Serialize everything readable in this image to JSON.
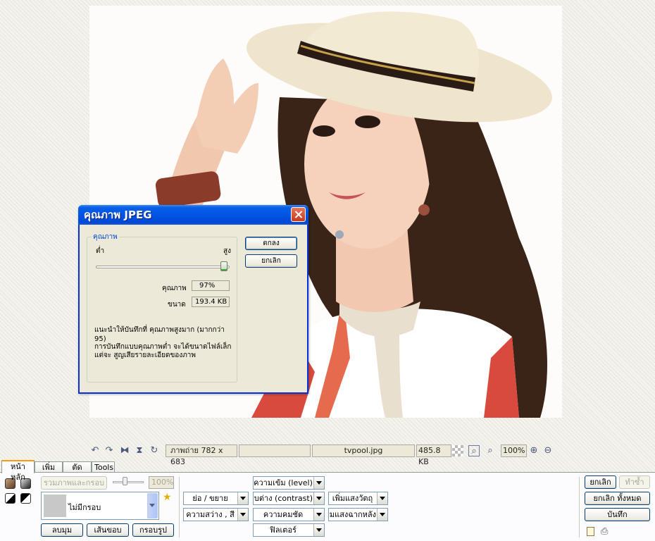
{
  "dialog": {
    "title": "คุณภาพ JPEG",
    "group_label": "คุณภาพ",
    "low_label": "ต่ำ",
    "high_label": "สูง",
    "quality_label": "คุณภาพ",
    "quality_value": "97%",
    "quality_slider_percent": 97,
    "size_label": "ขนาด",
    "size_value": "193.4 KB",
    "tip_line1": "แนะนำให้บันทึกที่ คุณภาพสูงมาก (มากกว่า 95)",
    "tip_line2": "การบันทึกแบบคุณภาพต่ำ จะได้ขนาดไฟล์เล็ก",
    "tip_line3": "แต่จะ สูญเสียรายละเอียดของภาพ",
    "ok_label": "ตกลง",
    "cancel_label": "ยกเลิก"
  },
  "status": {
    "dimensions": "ภาพถ่าย 782 x 683",
    "extra": "",
    "filename": "tvpool.jpg",
    "filesize": "485.8 KB",
    "zoom": "100%"
  },
  "tabs": [
    "หน้าหลัก",
    "เพิ่มวัตถุ",
    "ตัดภาพ",
    "Tools"
  ],
  "frame": {
    "merge_label": "รวมภาพและกรอบ",
    "opacity": "100%",
    "frame_selected": "ไม่มีกรอบ",
    "corner_label": "ลบมุม",
    "border_label": "เส้นขอบ",
    "shape_label": "กรอบรูป"
  },
  "adjust": {
    "resize": "ย่อ / ขยาย",
    "brightness": "ความสว่าง , สี",
    "level": "ความเข้ม (level)",
    "contrast": "เปรียบต่าง (contrast)",
    "sharpen": "ความคมชัด",
    "filter": "ฟิลเตอร์",
    "light_object": "เพิ่มแสงวัตถุ",
    "light_bg": "เพิ่มแสงฉากหลัง"
  },
  "actions": {
    "undo": "ยกเลิก",
    "redo": "ทำซ้ำ",
    "undo_all": "ยกเลิก ทั้งหมด",
    "save": "บันทึก"
  },
  "icons": {
    "rotate_left": "rotate-left-icon",
    "rotate_right": "rotate-right-icon",
    "flip_h": "flip-horizontal-icon",
    "flip_v": "flip-vertical-icon",
    "zoom_fit": "zoom-fit-icon",
    "zoom_actual": "zoom-actual-icon",
    "zoom_in": "zoom-in-icon",
    "zoom_out": "zoom-out-icon"
  }
}
